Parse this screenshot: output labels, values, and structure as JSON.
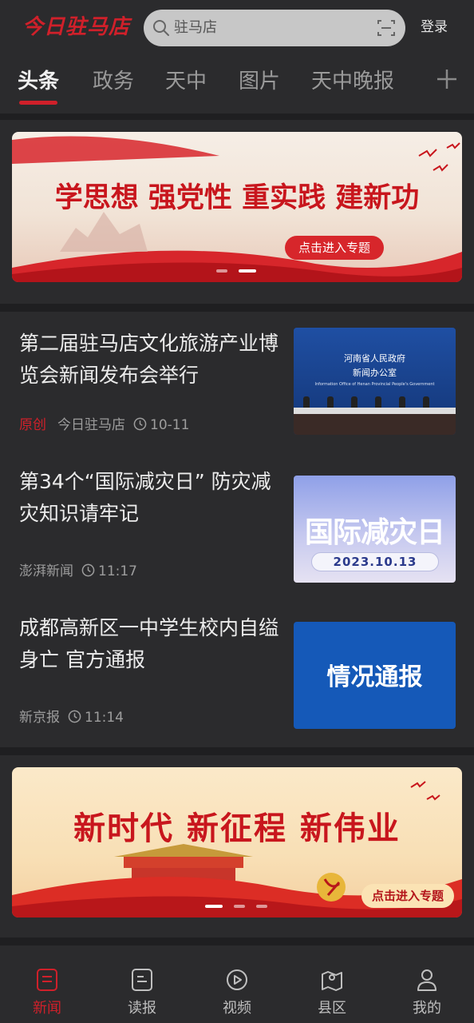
{
  "header": {
    "logo_text": "今日驻马店",
    "search_placeholder": "驻马店",
    "login_label": "登录"
  },
  "tabs": [
    {
      "label": "头条",
      "active": true
    },
    {
      "label": "政务",
      "active": false
    },
    {
      "label": "天中",
      "active": false
    },
    {
      "label": "图片",
      "active": false
    },
    {
      "label": "天中晚报",
      "active": false
    }
  ],
  "banner_top": {
    "title": "学思想 强党性 重实践 建新功",
    "button": "点击进入专题"
  },
  "news": [
    {
      "title": "第二届驻马店文化旅游产业博览会新闻发布会举行",
      "tag": "原创",
      "source": "今日驻马店",
      "time": "10-11",
      "thumb_line1": "河南省人民政府",
      "thumb_line2": "新闻办公室",
      "thumb_line3": "Information Office of Henan Provincial People's Government"
    },
    {
      "title": "第34个“国际减灾日” 防灾减灾知识请牢记",
      "tag": "",
      "source": "澎湃新闻",
      "time": "11:17",
      "thumb_big": "国际减灾日",
      "thumb_date": "2023.10.13"
    },
    {
      "title": "成都高新区一中学生校内自缢身亡 官方通报",
      "tag": "",
      "source": "新京报",
      "time": "11:14",
      "thumb_big": "情况通报"
    }
  ],
  "banner_bottom": {
    "title": "新时代 新征程 新伟业",
    "button": "点击进入专题"
  },
  "bottom_nav": [
    {
      "label": "新闻",
      "icon": "news-icon",
      "active": true
    },
    {
      "label": "读报",
      "icon": "newspaper-icon",
      "active": false
    },
    {
      "label": "视频",
      "icon": "video-icon",
      "active": false
    },
    {
      "label": "县区",
      "icon": "map-icon",
      "active": false
    },
    {
      "label": "我的",
      "icon": "profile-icon",
      "active": false
    }
  ],
  "colors": {
    "accent": "#d0202a",
    "background": "#1f1f21",
    "panel": "#2b2b2d"
  }
}
